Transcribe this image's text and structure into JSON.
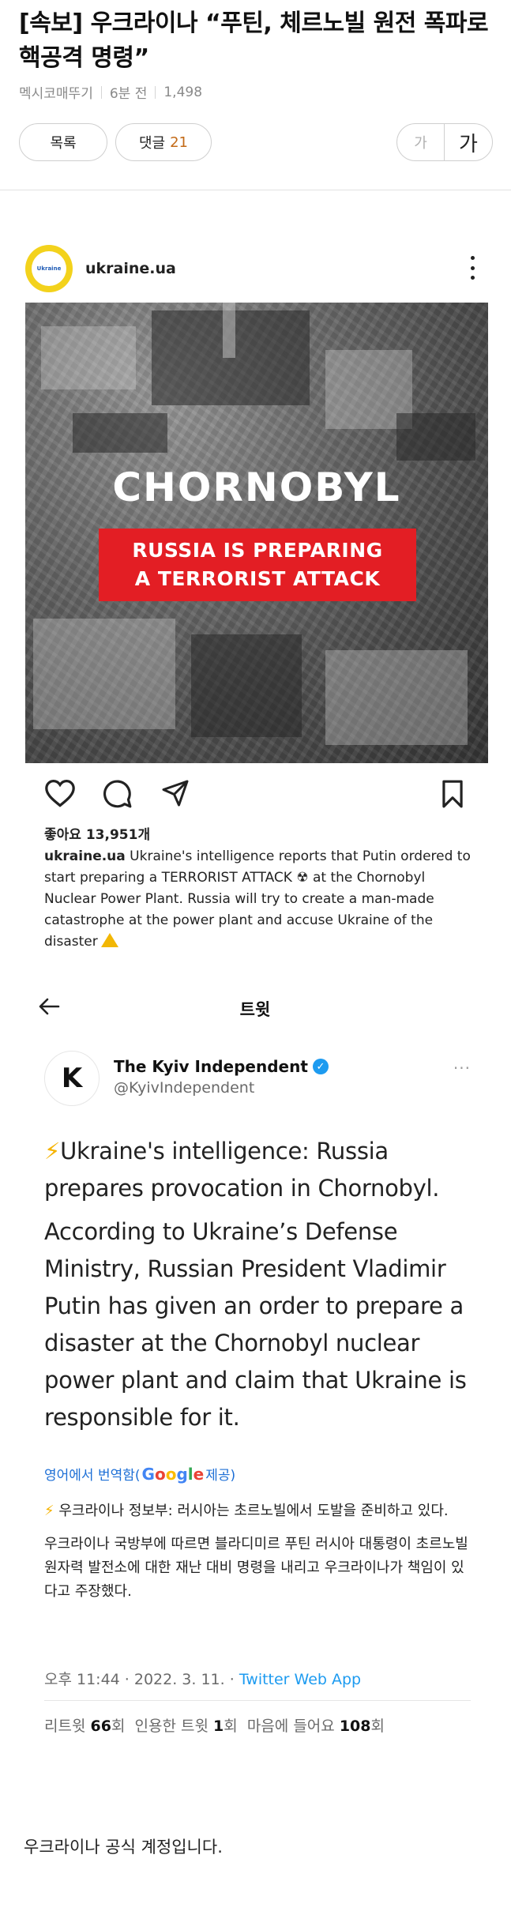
{
  "article": {
    "title": "[속보] 우크라이나 “푸틴, 체르노빌 원전 폭파로 핵공격 명령”",
    "board": "멕시코매뚜기",
    "time": "6분 전",
    "views": "1,498",
    "list_button": "목록",
    "comment_label": "댓글",
    "comment_count": "21",
    "font_small": "가",
    "font_large": "가",
    "body_text": "우크라이나 공식 계정입니다."
  },
  "instagram": {
    "username": "ukraine.ua",
    "avatar_text": "Ukraine",
    "image_headline": "CHORNOBYL",
    "image_banner_line1": "RUSSIA IS PREPARING",
    "image_banner_line2": "A TERRORIST ATTACK",
    "likes": "좋아요 13,951개",
    "caption_user": "ukraine.ua",
    "caption": " Ukraine's intelligence reports that Putin ordered to start preparing a TERRORIST ATTACK ☢ at the Chornobyl Nuclear Power Plant. Russia will try to create a man-made catastrophe at the power plant and accuse Ukraine of the disaster"
  },
  "tweet": {
    "nav_title": "트윗",
    "avatar_letter": "K",
    "name": "The Kyiv Independent",
    "handle": "@KyivIndependent",
    "more": "···",
    "body_p1": "Ukraine's intelligence: Russia prepares provocation in Chornobyl.",
    "body_p2": "According to Ukraine’s Defense Ministry, Russian President Vladimir Putin has given an order to prepare a disaster at the Chornobyl nuclear power plant and claim that Ukraine is responsible for it.",
    "translate_prefix": "영어에서 번역함(",
    "translate_suffix": " 제공)",
    "kr_p1": "우크라이나 정보부: 러시아는 초르노빌에서 도발을 준비하고 있다.",
    "kr_p2": "우크라이나 국방부에 따르면 블라디미르 푸틴 러시아 대통령이 초르노빌 원자력 발전소에 대한 재난 대비 명령을 내리고 우크라이나가 책임이 있다고 주장했다.",
    "time": "오후 11:44 · 2022. 3. 11. · ",
    "app": "Twitter Web App",
    "retweets_label": "리트윗",
    "retweets": "66",
    "quotes_label": "인용한 트윗",
    "quotes": "1",
    "likes_label": "마음에 들어요",
    "likes": "108",
    "unit": "회"
  },
  "icons": [
    "heart-icon",
    "comment-icon",
    "share-icon",
    "bookmark-icon",
    "back-arrow-icon",
    "verified-icon",
    "more-icon",
    "warning-icon",
    "lightning-icon"
  ]
}
